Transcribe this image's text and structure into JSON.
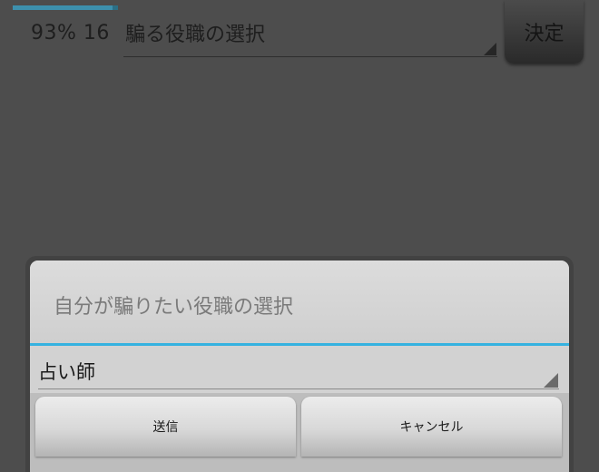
{
  "background": {
    "progress_fraction": 0.95,
    "status_text": "93% 16",
    "role_spinner_label": "騙る役職の選択",
    "decide_button_label": "決定"
  },
  "dialog": {
    "title": "自分が騙りたい役職の選択",
    "selected_role": "占い師",
    "send_button_label": "送信",
    "cancel_button_label": "キャンセル"
  },
  "icons": {
    "spinner_arrow": "dropdown-corner-triangle-icon"
  },
  "colors": {
    "accent_divider": "#35b2e0",
    "progress_bar": "#3d90ad"
  }
}
